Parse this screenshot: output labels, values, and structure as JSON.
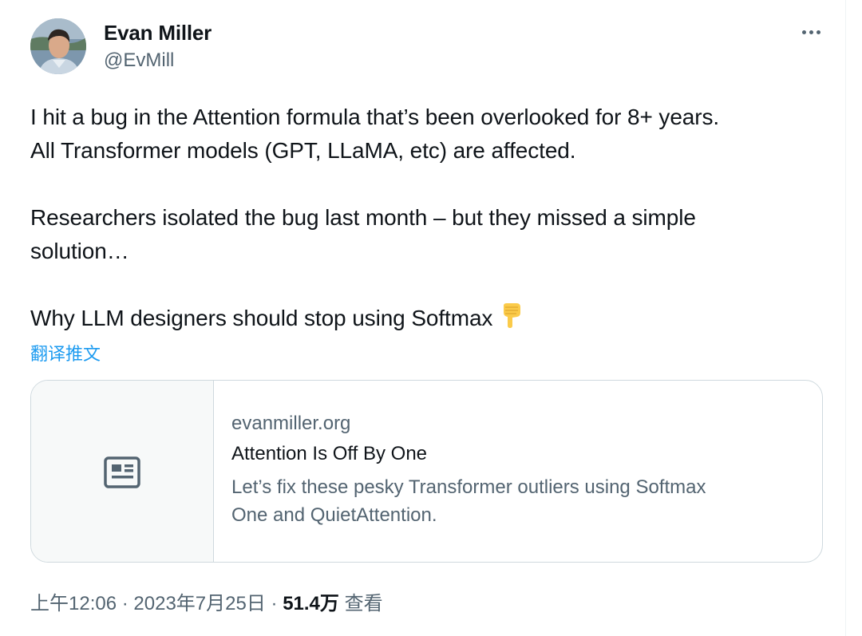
{
  "author": {
    "name": "Evan Miller",
    "handle": "@EvMill"
  },
  "tweet": {
    "lines": [
      "I hit a bug in the Attention formula that’s been overlooked for 8+ years.",
      "All Transformer models (GPT, LLaMA, etc) are affected.",
      "Researchers isolated the bug last month – but they missed a simple",
      "solution…",
      "Why LLM designers should stop using Softmax"
    ],
    "emoji": "backhand-index-pointing-down",
    "translate_label": "翻译推文"
  },
  "link_card": {
    "icon": "article-icon",
    "domain": "evanmiller.org",
    "title": "Attention Is Off By One",
    "description_line1": "Let’s fix these pesky Transformer outliers using Softmax",
    "description_line2": "One and QuietAttention."
  },
  "meta": {
    "time": "上午12:06",
    "separator1": "·",
    "date": "2023年7月25日",
    "separator2": "·",
    "views_count": "51.4万",
    "views_label": "查看"
  },
  "colors": {
    "text_primary": "#0f1419",
    "text_secondary": "#536471",
    "link": "#1d9bf0",
    "border": "#cfd9de",
    "emoji": "#fbcb4a"
  }
}
